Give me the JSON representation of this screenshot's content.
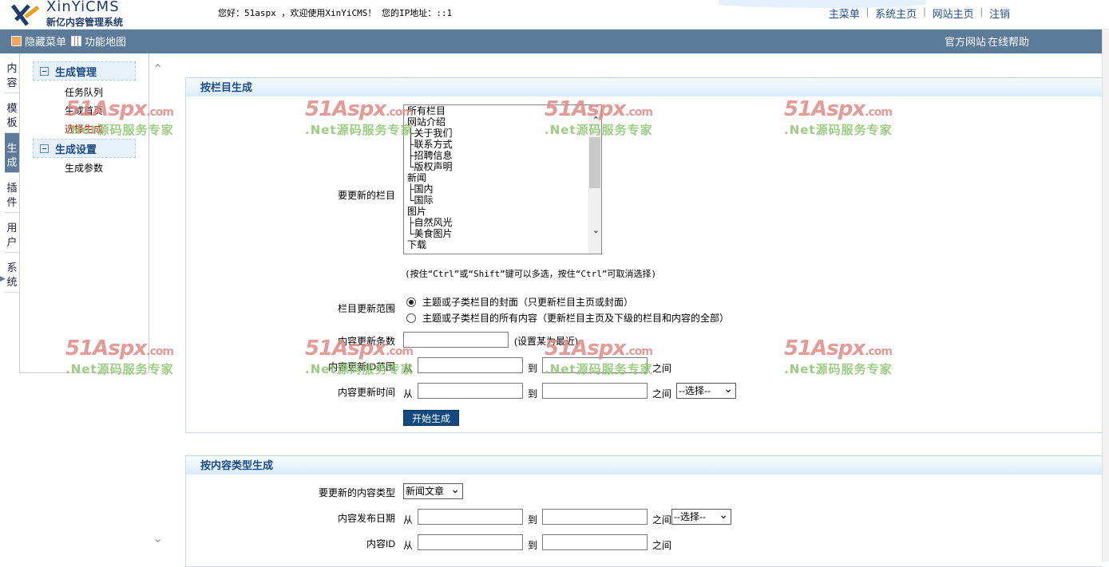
{
  "header": {
    "brand_en": "XinYiCMS",
    "brand_cn": "新亿内容管理系统",
    "welcome": "您好：51aspx ，欢迎使用XinYiCMS！ 您的IP地址：::1",
    "nav": [
      "主菜单",
      "系统主页",
      "网站主页",
      "注销"
    ]
  },
  "menubar": {
    "hide_menu": "隐藏菜单",
    "sitemap": "功能地图",
    "official_site": "官方网站",
    "online_help": "在线帮助"
  },
  "left_tabs": [
    "内容",
    "模板",
    "生成",
    "插件",
    "用户",
    "系统"
  ],
  "sidebar": {
    "groups": [
      {
        "title": "生成管理",
        "items": [
          "任务队列",
          "生成首页",
          "选择生成"
        ]
      },
      {
        "title": "生成设置",
        "items": [
          "生成参数"
        ]
      }
    ]
  },
  "section1": {
    "title": "按栏目生成",
    "columns_label": "要更新的栏目",
    "columns": [
      "所有栏目",
      "网站介绍",
      "├关于我们",
      "├联系方式",
      "├招聘信息",
      "└版权声明",
      "新闻",
      "├国内",
      "└国际",
      "图片",
      "├自然风光",
      "└美食图片",
      "下载"
    ],
    "multi_hint": "(按住“Ctrl”或“Shift”键可以多选，按住“Ctrl”可取消选择)",
    "range_label": "栏目更新范围",
    "range_opt1": "主题或子类栏目的封面（只更新栏目主页或封面）",
    "range_opt2": "主题或子类栏目的所有内容（更新栏目主页及下级的栏目和内容的全部）",
    "count_label": "内容更新条数",
    "count_hint": "(设置某为最近)",
    "idrange_label": "内容更新ID范围",
    "time_label": "内容更新时间",
    "from": "从",
    "to": "到",
    "between": "之间",
    "select_default": "--选择--",
    "start_button": "开始生成"
  },
  "section2": {
    "title": "按内容类型生成",
    "type_label": "要更新的内容类型",
    "type_value": "新闻文章",
    "date_label": "内容发布日期",
    "id_label": "内容ID",
    "from": "从",
    "to": "到",
    "between": "之间",
    "select_default": "--选择--"
  },
  "watermark": {
    "line1": "51Aspx",
    "suffix": ".com",
    "line2": ".Net源码服务专家"
  },
  "colors": {
    "menubar": "#5b7b99",
    "brand": "#1d3c6a",
    "section_title": "#1b4b86",
    "button": "#114a7e"
  }
}
